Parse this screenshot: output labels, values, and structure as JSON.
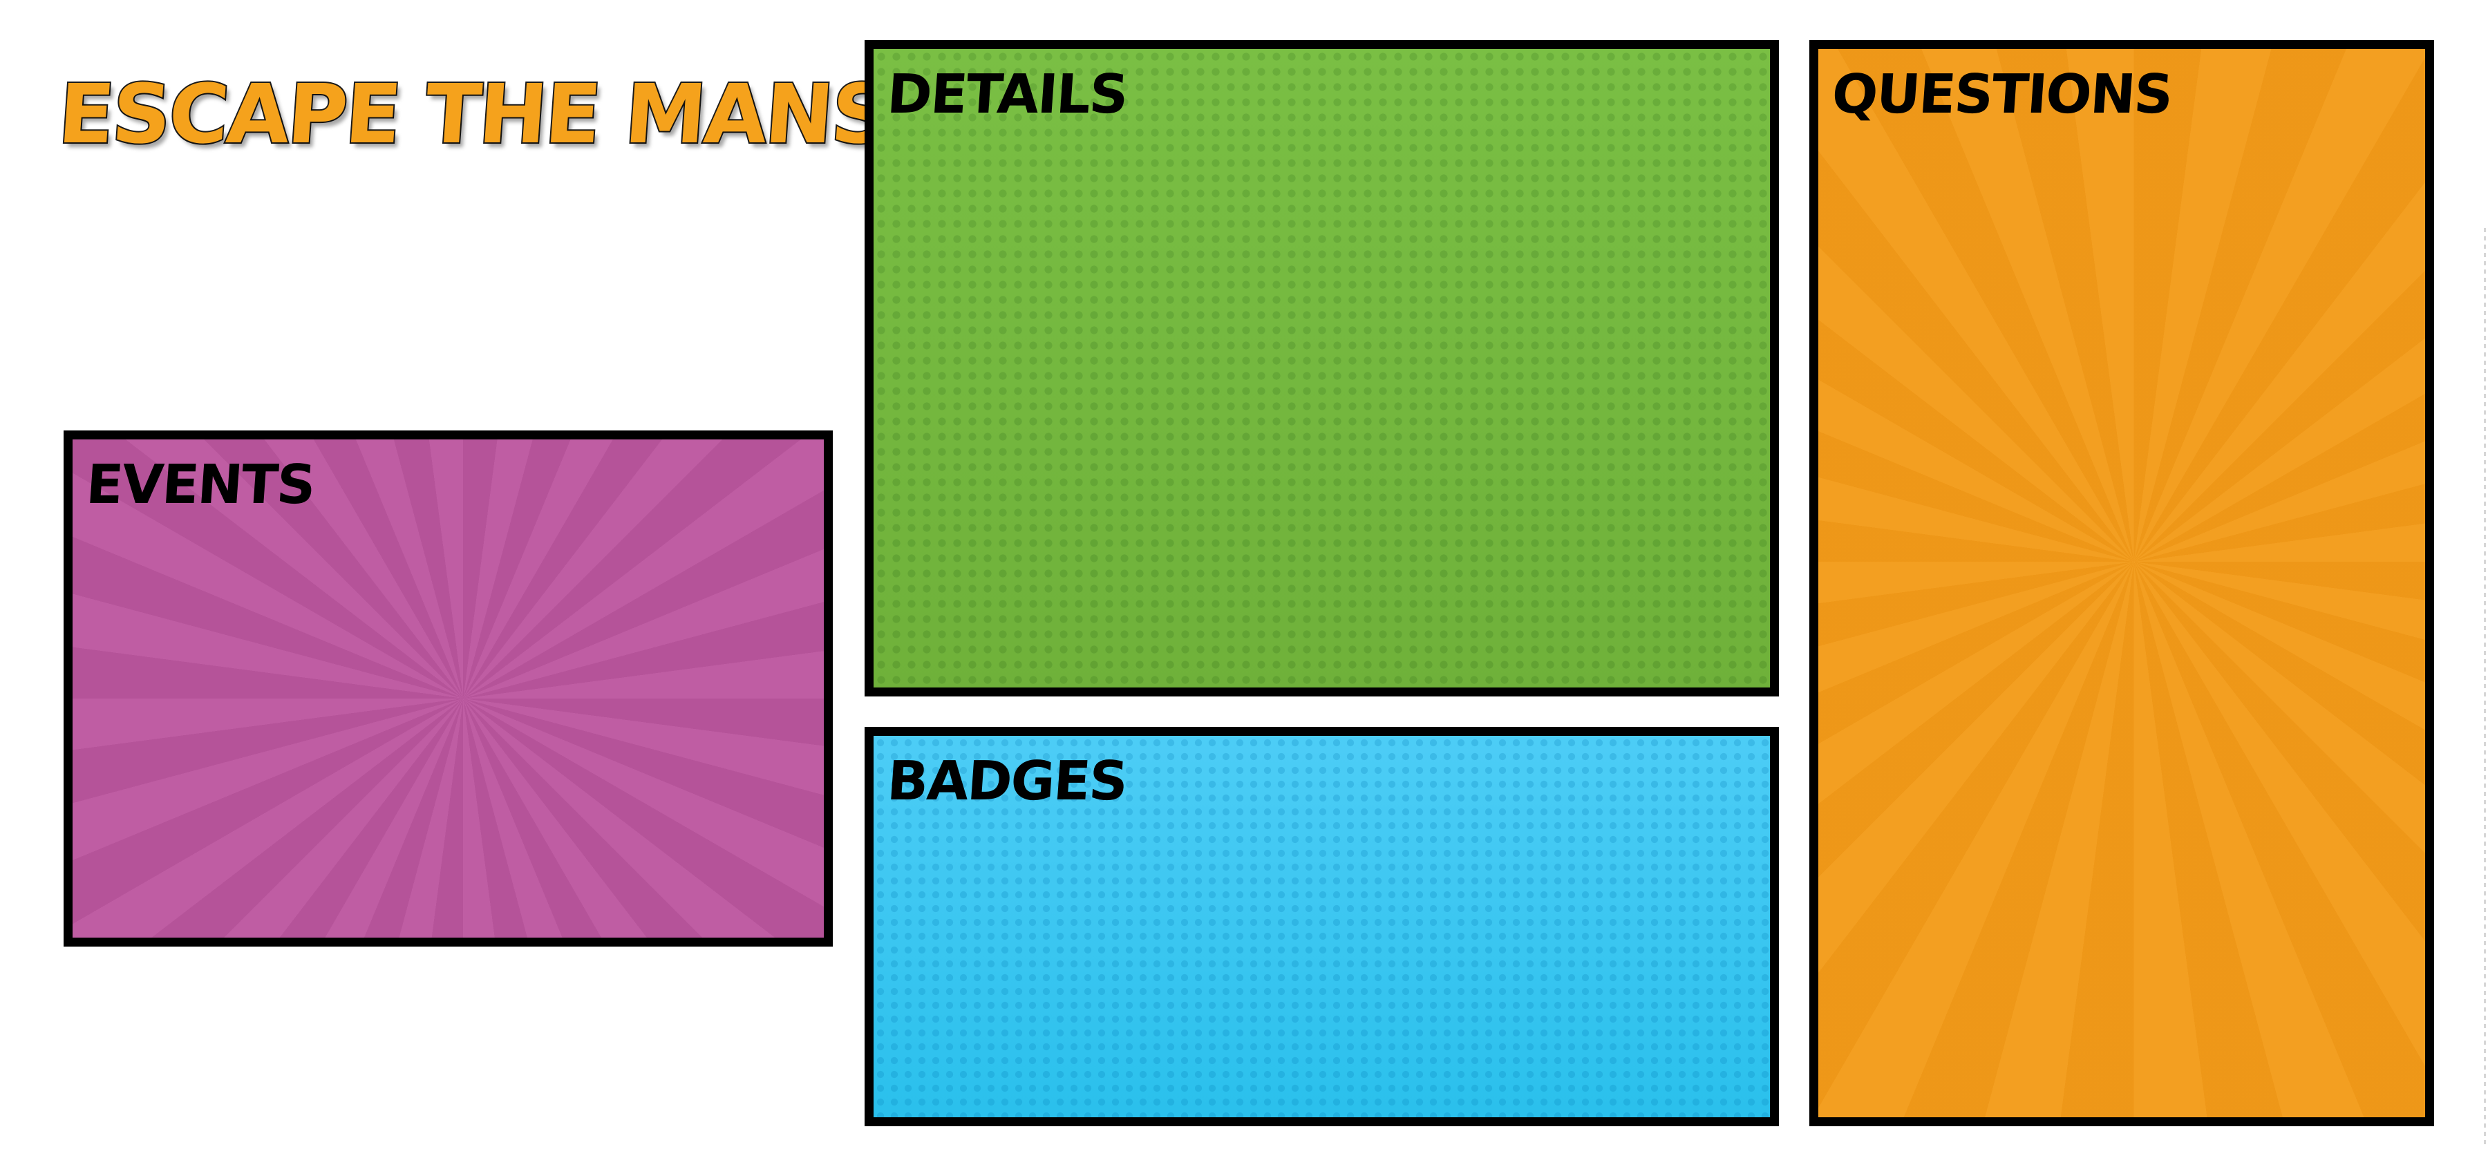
{
  "board": {
    "title": "ESCAPE THE MANSION"
  },
  "panels": {
    "events": {
      "label": "EVENTS",
      "color": "#bd57a0",
      "pattern": "sunburst"
    },
    "details": {
      "label": "DETAILS",
      "color": "#74b83f",
      "pattern": "halftone"
    },
    "badges": {
      "label": "BADGES",
      "color": "#3cc7f2",
      "pattern": "halftone"
    },
    "questions": {
      "label": "QUESTIONS",
      "color": "#f39c1a",
      "pattern": "sunburst"
    }
  }
}
